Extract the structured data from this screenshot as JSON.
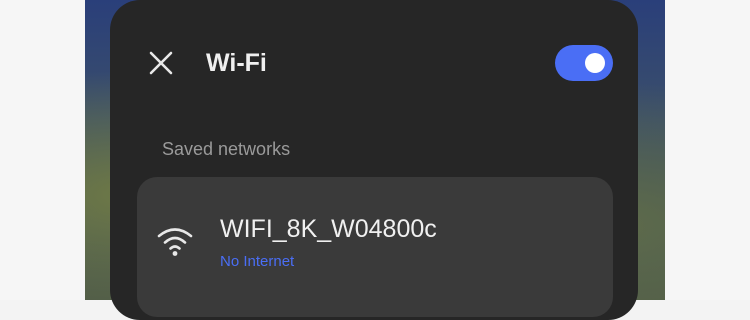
{
  "header": {
    "title": "Wi-Fi",
    "close_icon": "close-icon",
    "wifi_enabled": true
  },
  "saved_networks": {
    "header": "Saved networks",
    "items": [
      {
        "name": "WIFI_8K_W04800c",
        "status": "No Internet",
        "icon": "wifi-signal-icon"
      }
    ]
  },
  "colors": {
    "panel_background": "#262626",
    "card_background": "#3a3a3a",
    "accent": "#4a6ef5",
    "primary_text": "#f0f0f0",
    "secondary_text": "#9a9a9a"
  }
}
